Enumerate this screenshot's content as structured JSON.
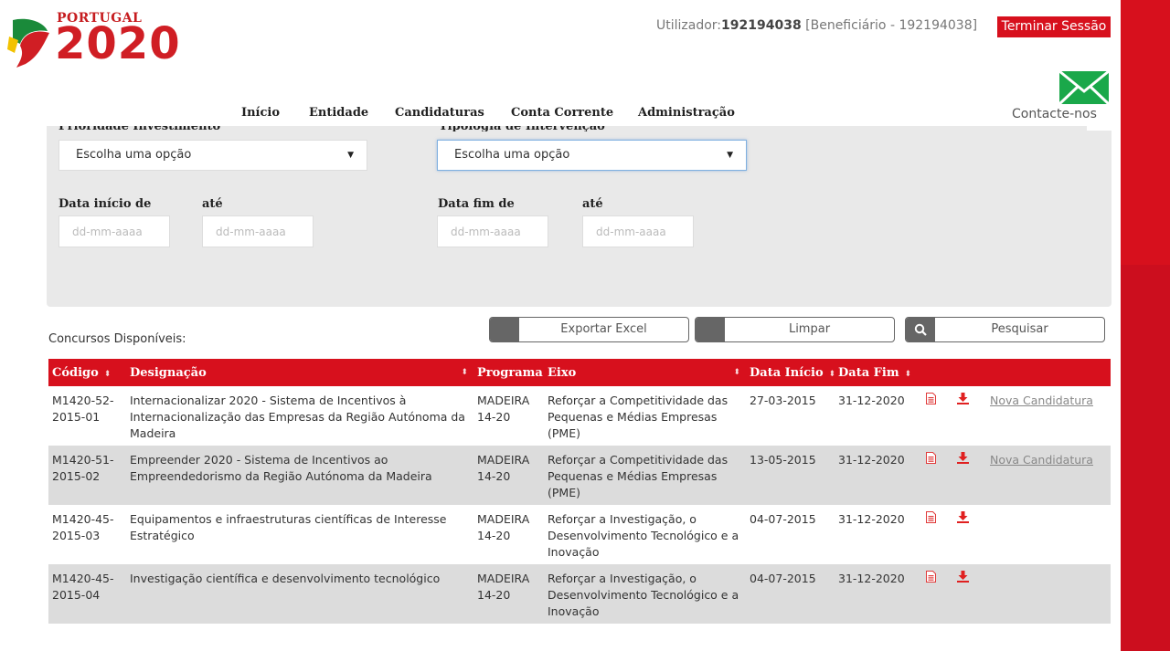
{
  "header": {
    "logo_small": "PORTUGAL",
    "logo_big": "2020",
    "user_label": "Utilizador:",
    "user_id": "192194038",
    "user_role": "[Beneficiário - 192194038]",
    "logout_label": "Terminar Sessão",
    "contact_label": "Contacte-nos"
  },
  "nav": {
    "items": [
      {
        "label": "Início"
      },
      {
        "label": "Entidade"
      },
      {
        "label": "Candidaturas"
      },
      {
        "label": "Conta Corrente"
      },
      {
        "label": "Administração"
      }
    ]
  },
  "filters": {
    "prioridade_label": "Prioridade Investimento",
    "prioridade_value": "Escolha uma opção",
    "tipologia_label": "Tipologia de Intervenção",
    "tipologia_value": "Escolha uma opção",
    "data_inicio_label": "Data início de",
    "data_inicio_ate_label": "até",
    "data_fim_label": "Data fim de",
    "data_fim_ate_label": "até",
    "date_placeholder": "dd-mm-aaaa"
  },
  "list": {
    "title": "Concursos Disponíveis:",
    "export_label": "Exportar Excel",
    "clear_label": "Limpar",
    "search_label": "Pesquisar"
  },
  "table": {
    "headers": {
      "codigo": "Código",
      "designacao": "Designação",
      "programa": "Programa",
      "eixo": "Eixo",
      "data_inicio": "Data Início",
      "data_fim": "Data Fim"
    },
    "rows": [
      {
        "codigo": "M1420-52-2015-01",
        "designacao": "Internacionalizar 2020 - Sistema de Incentivos à Internacionalização das Empresas da Região Autónoma da Madeira",
        "programa": "MADEIRA 14-20",
        "eixo": "Reforçar a Competitividade das Pequenas e Médias Empresas (PME)",
        "data_inicio": "27-03-2015",
        "data_fim": "31-12-2020",
        "action": "Nova Candidatura"
      },
      {
        "codigo": "M1420-51-2015-02",
        "designacao": "Empreender 2020 - Sistema de Incentivos ao Empreendedorismo da Região Autónoma da Madeira",
        "programa": "MADEIRA 14-20",
        "eixo": "Reforçar a Competitividade das Pequenas e Médias Empresas (PME)",
        "data_inicio": "13-05-2015",
        "data_fim": "31-12-2020",
        "action": "Nova Candidatura"
      },
      {
        "codigo": "M1420-45-2015-03",
        "designacao": "Equipamentos e infraestruturas científicas de Interesse Estratégico",
        "programa": "MADEIRA 14-20",
        "eixo": "Reforçar a Investigação, o Desenvolvimento Tecnológico e a Inovação",
        "data_inicio": "04-07-2015",
        "data_fim": "31-12-2020",
        "action": ""
      },
      {
        "codigo": "M1420-45-2015-04",
        "designacao": "Investigação científica e desenvolvimento tecnológico",
        "programa": "MADEIRA 14-20",
        "eixo": "Reforçar a Investigação, o Desenvolvimento Tecnológico e a Inovação",
        "data_inicio": "04-07-2015",
        "data_fim": "31-12-2020",
        "action": ""
      }
    ]
  },
  "colors": {
    "brand_red": "#d7101d",
    "panel_grey": "#e9e9e9",
    "row_alt": "#dcdcdc"
  }
}
